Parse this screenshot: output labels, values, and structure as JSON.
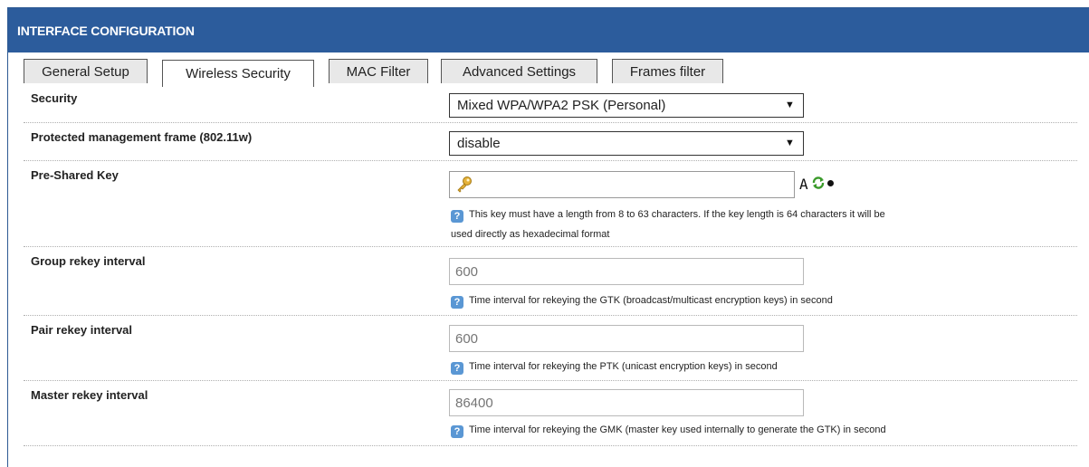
{
  "header": {
    "title": "INTERFACE CONFIGURATION"
  },
  "tabs": [
    {
      "label": "General Setup",
      "active": false
    },
    {
      "label": "Wireless Security",
      "active": true
    },
    {
      "label": "MAC Filter",
      "active": false
    },
    {
      "label": "Advanced Settings",
      "active": false
    },
    {
      "label": "Frames filter",
      "active": false
    }
  ],
  "security": {
    "label": "Security",
    "value": "Mixed WPA/WPA2 PSK (Personal)"
  },
  "pmf": {
    "label": "Protected management frame (802.11w)",
    "value": "disable"
  },
  "psk": {
    "label": "Pre-Shared Key",
    "value": "",
    "tool_font_label": "A",
    "help_line1": "This key must have a length from 8 to 63 characters. If the key length is 64 characters it will be",
    "help_line2": "used directly as hexadecimal format"
  },
  "group_rekey": {
    "label": "Group rekey interval",
    "placeholder": "600",
    "help": "Time interval for rekeying the GTK (broadcast/multicast encryption keys) in second"
  },
  "pair_rekey": {
    "label": "Pair rekey interval",
    "placeholder": "600",
    "help": "Time interval for rekeying the PTK (unicast encryption keys) in second"
  },
  "master_rekey": {
    "label": "Master rekey interval",
    "placeholder": "86400",
    "help": "Time interval for rekeying the GMK (master key used internally to generate the GTK) in second"
  },
  "colors": {
    "header_bg": "#2c5c9c",
    "help_icon": "#5a97d4"
  }
}
